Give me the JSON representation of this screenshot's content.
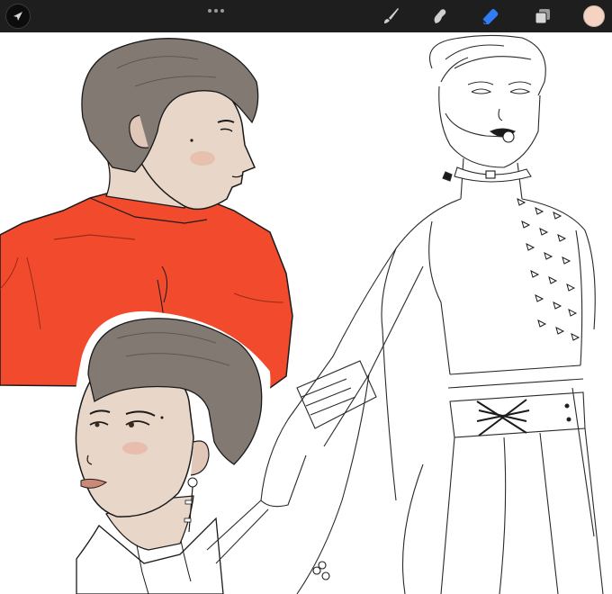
{
  "app": {
    "toolbar": {
      "actions_icon": "arrow-cursor-icon",
      "more_icon": "more-dots-icon",
      "brush_icon": "brush-icon",
      "smudge_icon": "smudge-icon",
      "eraser_icon": "eraser-icon",
      "layers_icon": "layers-icon",
      "active_tool": "eraser",
      "active_color": "#f5d3c3",
      "accent_color": "#2f7cf6"
    },
    "canvas": {
      "colors": {
        "hair": "#827a72",
        "skin": "#e8d6c9",
        "jacket": "#f24a2d",
        "line": "#1a1a1a",
        "background": "#ffffff"
      }
    }
  }
}
